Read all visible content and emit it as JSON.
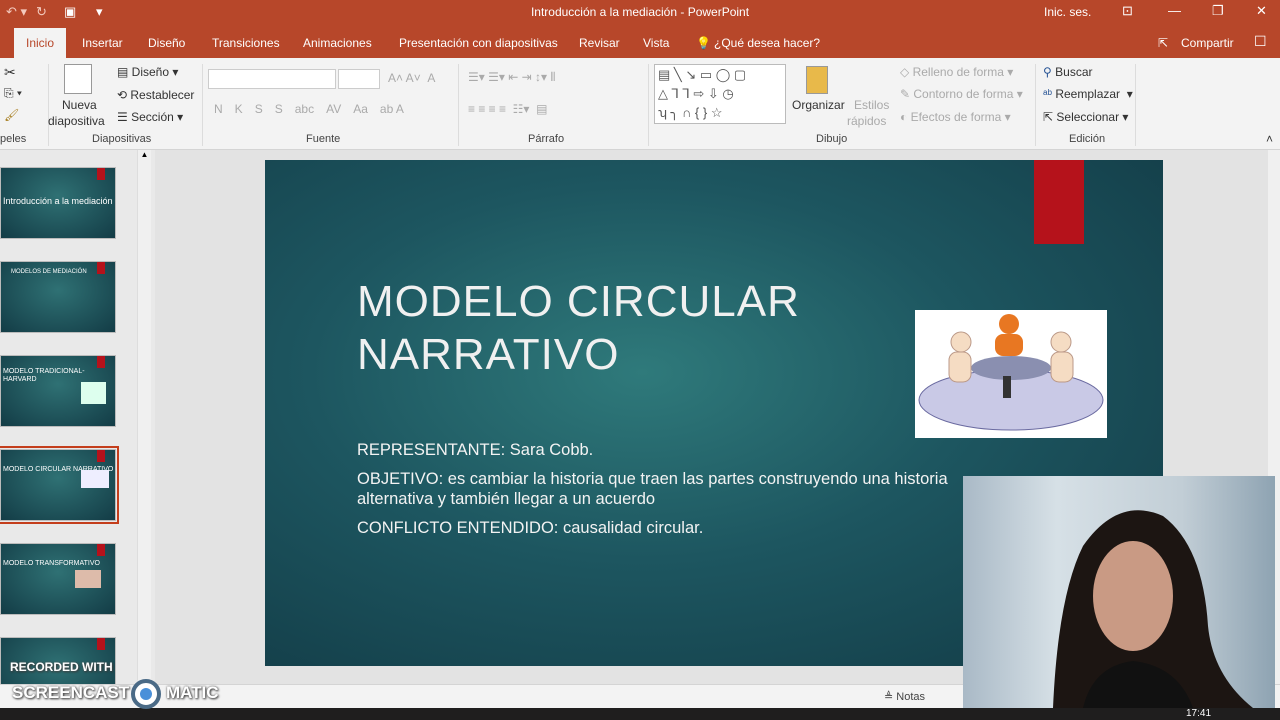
{
  "window": {
    "title": "Introducción a la mediación  -  PowerPoint",
    "signin": "Inic. ses."
  },
  "tabs": [
    "Inicio",
    "Insertar",
    "Diseño",
    "Transiciones",
    "Animaciones",
    "Presentación con diapositivas",
    "Revisar",
    "Vista"
  ],
  "tell_me": "¿Qué desea hacer?",
  "share": "Compartir",
  "ribbon": {
    "clipboard_label": "peles",
    "new_slide": [
      "Nueva",
      "diapositiva"
    ],
    "layout": "Diseño",
    "reset": "Restablecer",
    "section": "Sección",
    "slides_label": "Diapositivas",
    "font_buttons": [
      "N",
      "K",
      "S",
      "S",
      "abc",
      "AV",
      "Aa"
    ],
    "font_label": "Fuente",
    "paragraph_label": "Párrafo",
    "arrange": "Organizar",
    "quick_styles": [
      "Estilos",
      "rápidos"
    ],
    "shape_fill": "Relleno de forma",
    "shape_outline": "Contorno de forma",
    "shape_effects": "Efectos de forma",
    "drawing_label": "Dibujo",
    "find": "Buscar",
    "replace": "Reemplazar",
    "select": "Seleccionar",
    "editing_label": "Edición"
  },
  "thumbnails": [
    {
      "title": "Introducción a la mediación"
    },
    {
      "title": "MODELOS DE MEDIACIÓN"
    },
    {
      "title": "MODELO TRADICIONAL-HARVARD"
    },
    {
      "title": "MODELO CIRCULAR NARRATIVO",
      "selected": true
    },
    {
      "title": "MODELO TRANSFORMATIVO"
    },
    {
      "title": ""
    }
  ],
  "slide": {
    "title_line1": "MODELO CIRCULAR",
    "title_line2": "NARRATIVO",
    "body": [
      "REPRESENTANTE: Sara Cobb.",
      "OBJETIVO: es cambiar la historia que traen las partes construyendo una historia alternativa y también llegar a un acuerdo",
      "CONFLICTO ENTENDIDO: causalidad circular."
    ]
  },
  "status": {
    "notes": "Notas"
  },
  "watermark": {
    "line1": "RECORDED WITH",
    "line2a": "SCREENCAST",
    "line2b": "MATIC"
  },
  "taskbar": {
    "time": "17:41"
  },
  "colors": {
    "accent": "#b7472a",
    "slide_bg": "#1d5660",
    "slide_red": "#b5121b"
  }
}
